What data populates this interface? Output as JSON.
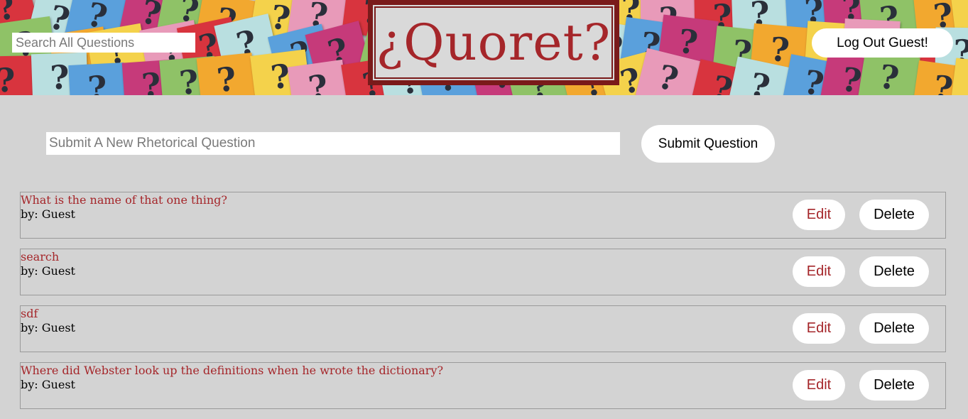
{
  "header": {
    "search_placeholder": "Search All Questions",
    "logo_text": "¿Quoret?",
    "logout_label": "Log Out Guest!",
    "note_glyph": "?"
  },
  "composer": {
    "placeholder": "Submit A New Rhetorical Question",
    "submit_label": "Submit Question"
  },
  "questions": [
    {
      "title": "What is the name of that one thing?",
      "author": "by: Guest",
      "edit_label": "Edit",
      "delete_label": "Delete"
    },
    {
      "title": "search",
      "author": "by: Guest",
      "edit_label": "Edit",
      "delete_label": "Delete"
    },
    {
      "title": "sdf",
      "author": "by: Guest",
      "edit_label": "Edit",
      "delete_label": "Delete"
    },
    {
      "title": "Where did Webster look up the definitions when he wrote the dictionary?",
      "author": "by: Guest",
      "edit_label": "Edit",
      "delete_label": "Delete"
    }
  ],
  "colors": {
    "accent": "#a5262a",
    "logo_border": "#7a1a1a",
    "page_bg": "#d3d3d3",
    "note_colors": [
      "#d8343e",
      "#f2a82f",
      "#5aa0dc",
      "#e89ab9",
      "#8fc267",
      "#b9dfe0",
      "#f4d24b",
      "#c63a7a"
    ]
  }
}
